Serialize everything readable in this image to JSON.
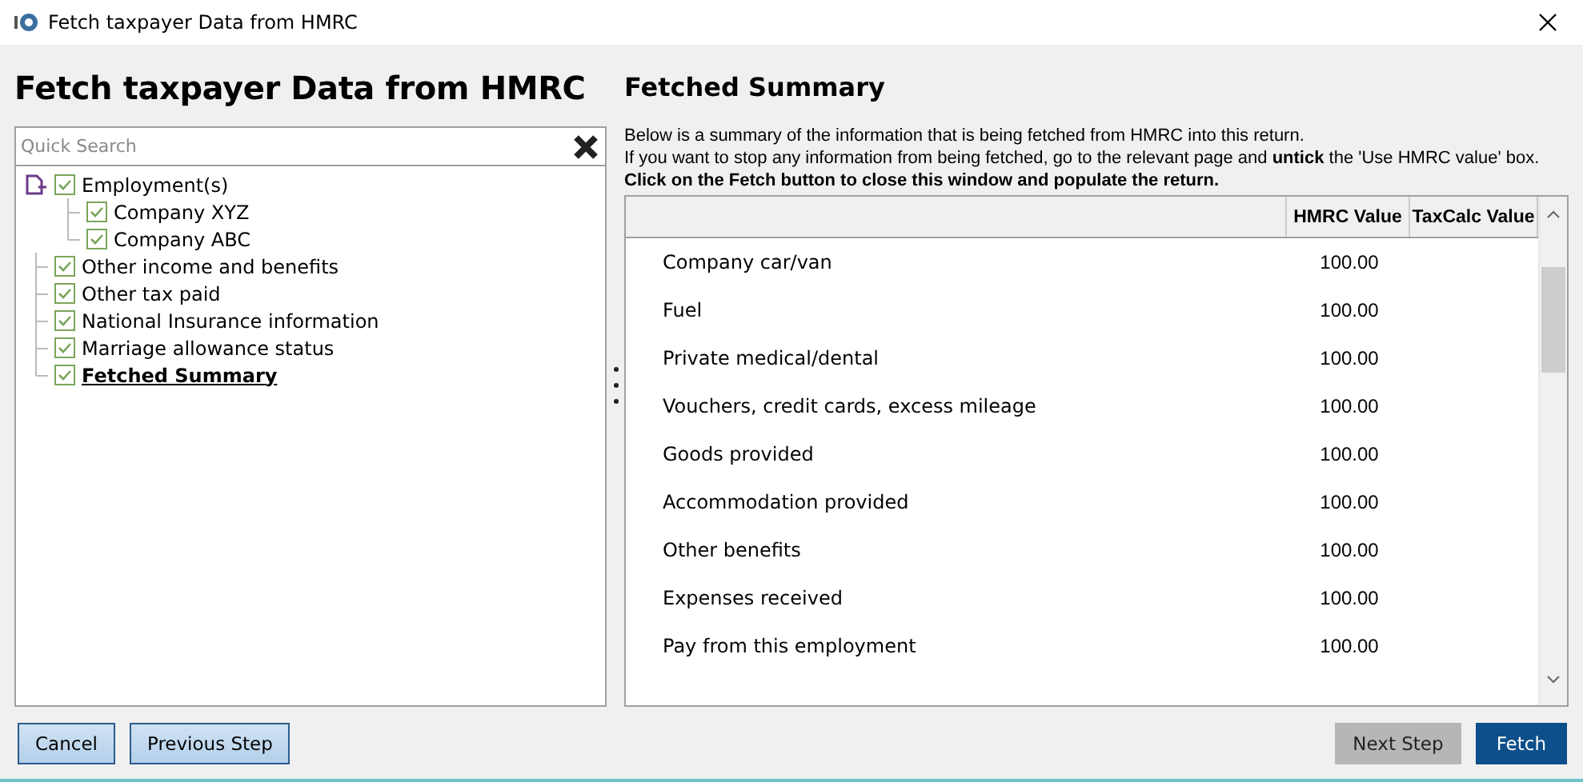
{
  "window": {
    "title": "Fetch taxpayer Data from HMRC"
  },
  "heading": "Fetch taxpayer Data from HMRC",
  "search": {
    "placeholder": "Quick Search"
  },
  "tree": [
    {
      "label": "Employment(s)",
      "checked": true,
      "selected": false,
      "children": [
        {
          "label": "Company XYZ",
          "checked": true,
          "selected": false
        },
        {
          "label": "Company ABC",
          "checked": true,
          "selected": false
        }
      ]
    },
    {
      "label": "Other income and benefits",
      "checked": true,
      "selected": false
    },
    {
      "label": "Other tax paid",
      "checked": true,
      "selected": false
    },
    {
      "label": "National Insurance information",
      "checked": true,
      "selected": false
    },
    {
      "label": "Marriage allowance status",
      "checked": true,
      "selected": false
    },
    {
      "label": "Fetched Summary",
      "checked": true,
      "selected": true
    }
  ],
  "summary": {
    "title": "Fetched Summary",
    "lines": [
      "Below is a summary of the information that is being fetched from HMRC into this return.",
      "If you want to stop any information from being fetched, go to the relevant page and **untick** the 'Use HMRC value' box."
    ],
    "instruction": "Click on the Fetch button to close this window and populate the return."
  },
  "table": {
    "columns": [
      "HMRC Value",
      "TaxCalc Value"
    ],
    "rows": [
      {
        "label": "Company car/van",
        "hmrc": "100.00"
      },
      {
        "label": "Fuel",
        "hmrc": "100.00"
      },
      {
        "label": "Private medical/dental",
        "hmrc": "100.00"
      },
      {
        "label": "Vouchers, credit cards, excess mileage",
        "hmrc": "100.00"
      },
      {
        "label": "Goods provided",
        "hmrc": "100.00"
      },
      {
        "label": "Accommodation provided",
        "hmrc": "100.00"
      },
      {
        "label": "Other benefits",
        "hmrc": "100.00"
      },
      {
        "label": "Expenses received",
        "hmrc": "100.00"
      },
      {
        "label": "Pay from this employment",
        "hmrc": "100.00"
      }
    ]
  },
  "buttons": [
    {
      "label": "Cancel",
      "kind": "secondary",
      "disabled": false
    },
    {
      "label": "Previous Step",
      "kind": "secondary",
      "disabled": false
    },
    {
      "label": "Next Step",
      "kind": "secondary",
      "disabled": true
    },
    {
      "label": "Fetch",
      "kind": "primary",
      "disabled": false
    }
  ]
}
